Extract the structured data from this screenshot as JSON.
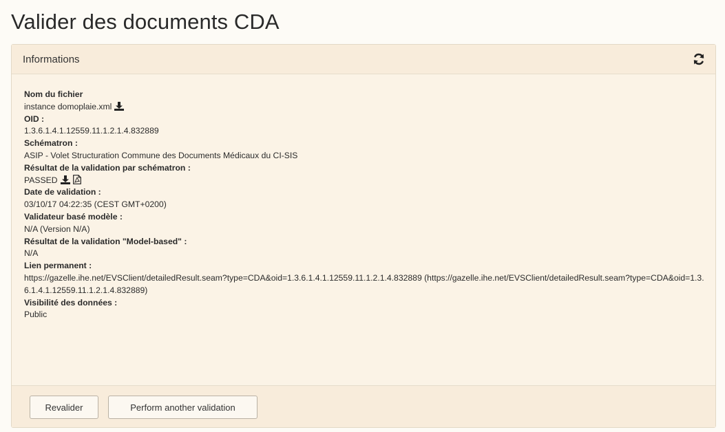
{
  "page": {
    "title": "Valider des documents CDA"
  },
  "panel": {
    "heading": "Informations",
    "fields": {
      "filename_label": "Nom du fichier",
      "filename_value": "instance domoplaie.xml",
      "oid_label": "OID :",
      "oid_value": "1.3.6.1.4.1.12559.11.1.2.1.4.832889",
      "schematron_label": "Schématron :",
      "schematron_value": "ASIP - Volet Structuration Commune des Documents Médicaux du CI-SIS",
      "schematron_result_label": "Résultat de la validation par schématron :",
      "schematron_result_value": "PASSED",
      "date_label": "Date de validation :",
      "date_value": "03/10/17 04:22:35 (CEST GMT+0200)",
      "model_validator_label": "Validateur basé modèle :",
      "model_validator_value": "N/A (Version N/A)",
      "model_result_label": "Résultat de la validation \"Model-based\" :",
      "model_result_value": "N/A",
      "permalink_label": "Lien permanent :",
      "permalink_value": "https://gazelle.ihe.net/EVSClient/detailedResult.seam?type=CDA&oid=1.3.6.1.4.1.12559.11.1.2.1.4.832889 (https://gazelle.ihe.net/EVSClient/detailedResult.seam?type=CDA&oid=1.3.6.1.4.1.12559.11.1.2.1.4.832889)",
      "visibility_label": "Visibilité des données :",
      "visibility_value": "Public"
    }
  },
  "footer": {
    "revalidate_label": "Revalider",
    "another_label": "Perform another validation"
  },
  "icons": {
    "refresh": "refresh-icon",
    "download": "download-icon",
    "pdf": "pdf-icon"
  }
}
